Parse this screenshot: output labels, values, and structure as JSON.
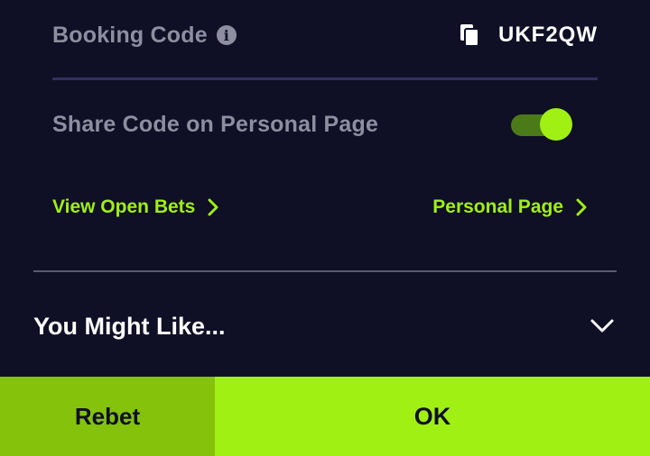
{
  "booking": {
    "label": "Booking Code",
    "info_icon": "info-icon",
    "copy_icon": "copy-icon",
    "code": "UKF2QW"
  },
  "share": {
    "label": "Share Code on Personal Page",
    "toggle_state": "on"
  },
  "links": {
    "open_bets": "View Open Bets",
    "personal_page": "Personal Page"
  },
  "recommendations": {
    "title": "You Might Like...",
    "expanded": false
  },
  "actions": {
    "rebet": "Rebet",
    "ok": "OK"
  },
  "colors": {
    "background": "#0f0f26",
    "accent": "#a0f014",
    "rebet_button": "#84c20c",
    "muted_text": "#8e8ea0"
  }
}
